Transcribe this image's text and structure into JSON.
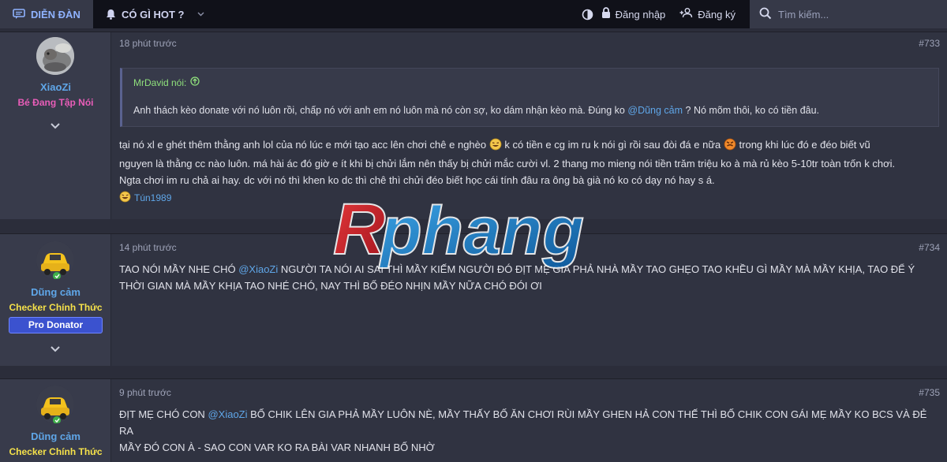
{
  "nav": {
    "forum_label": "DIỄN ĐÀN",
    "hot_label": "CÓ GÌ HOT ?",
    "login_label": "Đăng nhập",
    "register_label": "Đăng ký",
    "search_placeholder": "Tìm kiếm..."
  },
  "watermark": {
    "text": "Rphang"
  },
  "posts": [
    {
      "time": "18 phút trước",
      "number": "#733",
      "author": "XiaoZi",
      "user_title": "Bé Đang Tập Nói",
      "quote": {
        "author": "MrDavid nói:",
        "text_before": "Anh thách kèo donate với nó luôn rồi, chấp nó với anh em nó luôn mà nó còn sợ, ko dám nhận kèo mà. Đúng ko",
        "mention": "@Dũng cảm",
        "text_after": "? Nó mõm thôi, ko có tiền đâu."
      },
      "message": {
        "line1_a": "tại nó xl e ghét thêm thằng anh lol của nó lúc e mới tạo acc lên chơi chê e nghèo",
        "line1_b": "k có tiền e cg im ru k nói gì rồi sau đòi đá e nữa",
        "line1_c": "trong khi lúc đó e đéo biết vũ",
        "line2": "nguyen là thằng cc nào luôn. má hài ác đó giờ e ít khi bị chửi lắm nên thấy bị chửi mắc cười vl. 2 thang mo mieng nói tiền trăm triệu ko à mà rủ kèo 5-10tr toàn trốn k chơi.",
        "line3": "Ngta chơi im ru chả ai hay. dc với nó thì khen ko dc thì chê thì chửi đéo biết học cái tính đâu ra ông bà già nó ko có dạy nó hay s á."
      },
      "reaction_user": "Tún1989"
    },
    {
      "time": "14 phút trước",
      "number": "#734",
      "author": "Dũng cảm",
      "user_title": "Checker Chính Thức",
      "badge": "Pro Donator",
      "message": {
        "line1_a": "TAO NÓI MẦY NHE CHÓ",
        "mention": "@XiaoZi",
        "line1_b": "NGƯỜI TA NÓI AI SAI THÌ MẦY KIẾM NGƯỜI ĐÓ ĐỊT MẸ GIA PHẢ NHÀ MẦY TAO GHẸO TAO KHỀU GÌ MẦY MÀ MẦY KHỊA, TAO ĐỂ Ý",
        "line2": "THỜI GIAN MÀ MẦY KHỊA TAO NHÉ CHÓ, NAY THÌ BỐ ĐÉO NHỊN MẦY NỮA CHÓ ĐÓI ƠI"
      }
    },
    {
      "time": "9 phút trước",
      "number": "#735",
      "author": "Dũng cảm",
      "user_title": "Checker Chính Thức",
      "message": {
        "line1_a": "ĐỊT MẸ CHÓ CON",
        "mention": "@XiaoZi",
        "line1_b": "BỐ CHIK LÊN GIA PHẢ MẦY LUÔN NÈ, MẦY THẤY BỐ ĂN CHƠI RÙI MẦY GHEN HẢ CON THẾ THÌ BỐ CHIK CON GÁI MẸ MẦY KO BCS VÀ ĐẺ RA",
        "line2": "MẦY ĐÓ CON À - SAO CON VAR KO RA BÀI VAR NHANH BỐ NHỜ"
      }
    }
  ],
  "colors": {
    "background": "#2b2d3a",
    "nav_bg": "#101119",
    "link": "#5fa6e8",
    "title_pink": "#e85db8",
    "title_yellow": "#f5e14a",
    "badge": "#3b52cf"
  }
}
